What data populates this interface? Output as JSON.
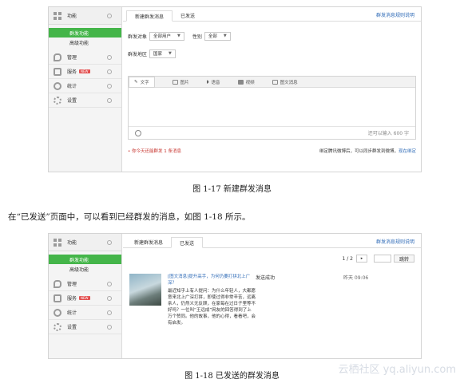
{
  "sidebar": {
    "func": "功能",
    "func_sub1": "群发功能",
    "func_sub2": "高级功能",
    "manage": "管理",
    "service": "服务",
    "service_badge": "NEW",
    "stats": "统计",
    "settings": "设置"
  },
  "fig1": {
    "tab_new": "新建群发消息",
    "tab_sent": "已发送",
    "rules_link": "群发消息规则说明",
    "target_label": "群发对象",
    "target_value": "全部用户",
    "gender_label": "性别",
    "gender_value": "全部",
    "region_label": "群发地区",
    "region_value": "国家",
    "tool_text": "文字",
    "tool_image": "图片",
    "tool_voice": "语音",
    "tool_video": "视频",
    "tool_news": "图文消息",
    "char_hint": "还可以输入 600 字",
    "quota_text": "• 你今天还能群发 1 条消息",
    "bind_text": "绑定腾讯微博后，可以同步群发到微博，",
    "bind_link": "现在绑定",
    "caption": "图 1-17   新建群发消息"
  },
  "body_text": "在“已发送”页面中，可以看到已经群发的消息，如图 1-18 所示。",
  "fig2": {
    "tab_new": "新建群发消息",
    "tab_sent": "已发送",
    "rules_link": "群发消息规则说明",
    "page_indicator": "1 / 2",
    "next_symbol": "▸",
    "jump_label": "跳转",
    "msg_title": "[图文消息]提升高手，为何仍要打拼北上广深？",
    "msg_body": "最近知乎上有人提问：为什么年轻人，大都愿意来北上广深打拼，即使过得非常辛苦，远离亲人，仍然义无反顾，在家每在过日子里等不好吗？一位叫“王远成”网友的回答得到了上万个赞同。他的故事，他的心得，看看吧，会有启发。",
    "msg_status": "发送成功",
    "msg_time": "昨天 09:06",
    "caption": "图 1-18   已发送的群发消息"
  },
  "watermark": "云栖社区 yq.aliyun.com"
}
